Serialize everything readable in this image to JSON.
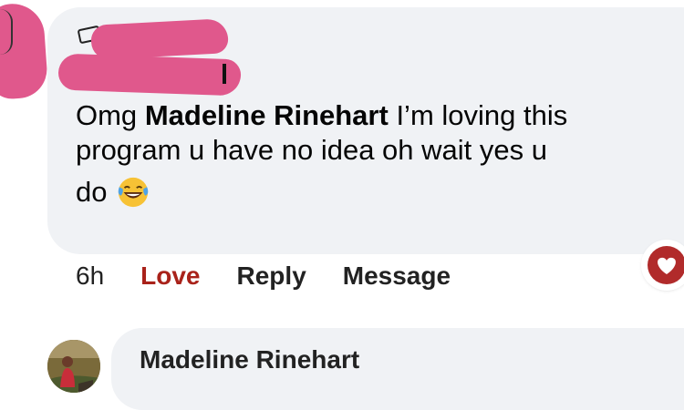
{
  "comment": {
    "text_prefix": "Omg",
    "mention": "Madeline Rinehart",
    "line1_suffix": "I’m loving this",
    "line2": "program u have no idea oh wait yes u",
    "line3": "do",
    "emoji": "face-with-tears-of-joy-emoji"
  },
  "actions": {
    "timestamp": "6h",
    "love": "Love",
    "reply": "Reply",
    "message": "Message"
  },
  "reaction": {
    "icon": "heart-icon",
    "color": "#b12b2b"
  },
  "reply": {
    "author": "Madeline Rinehart"
  },
  "colors": {
    "bubble": "#f0f2f5",
    "love_accent": "#a9221a",
    "redaction": "#e0588c"
  }
}
